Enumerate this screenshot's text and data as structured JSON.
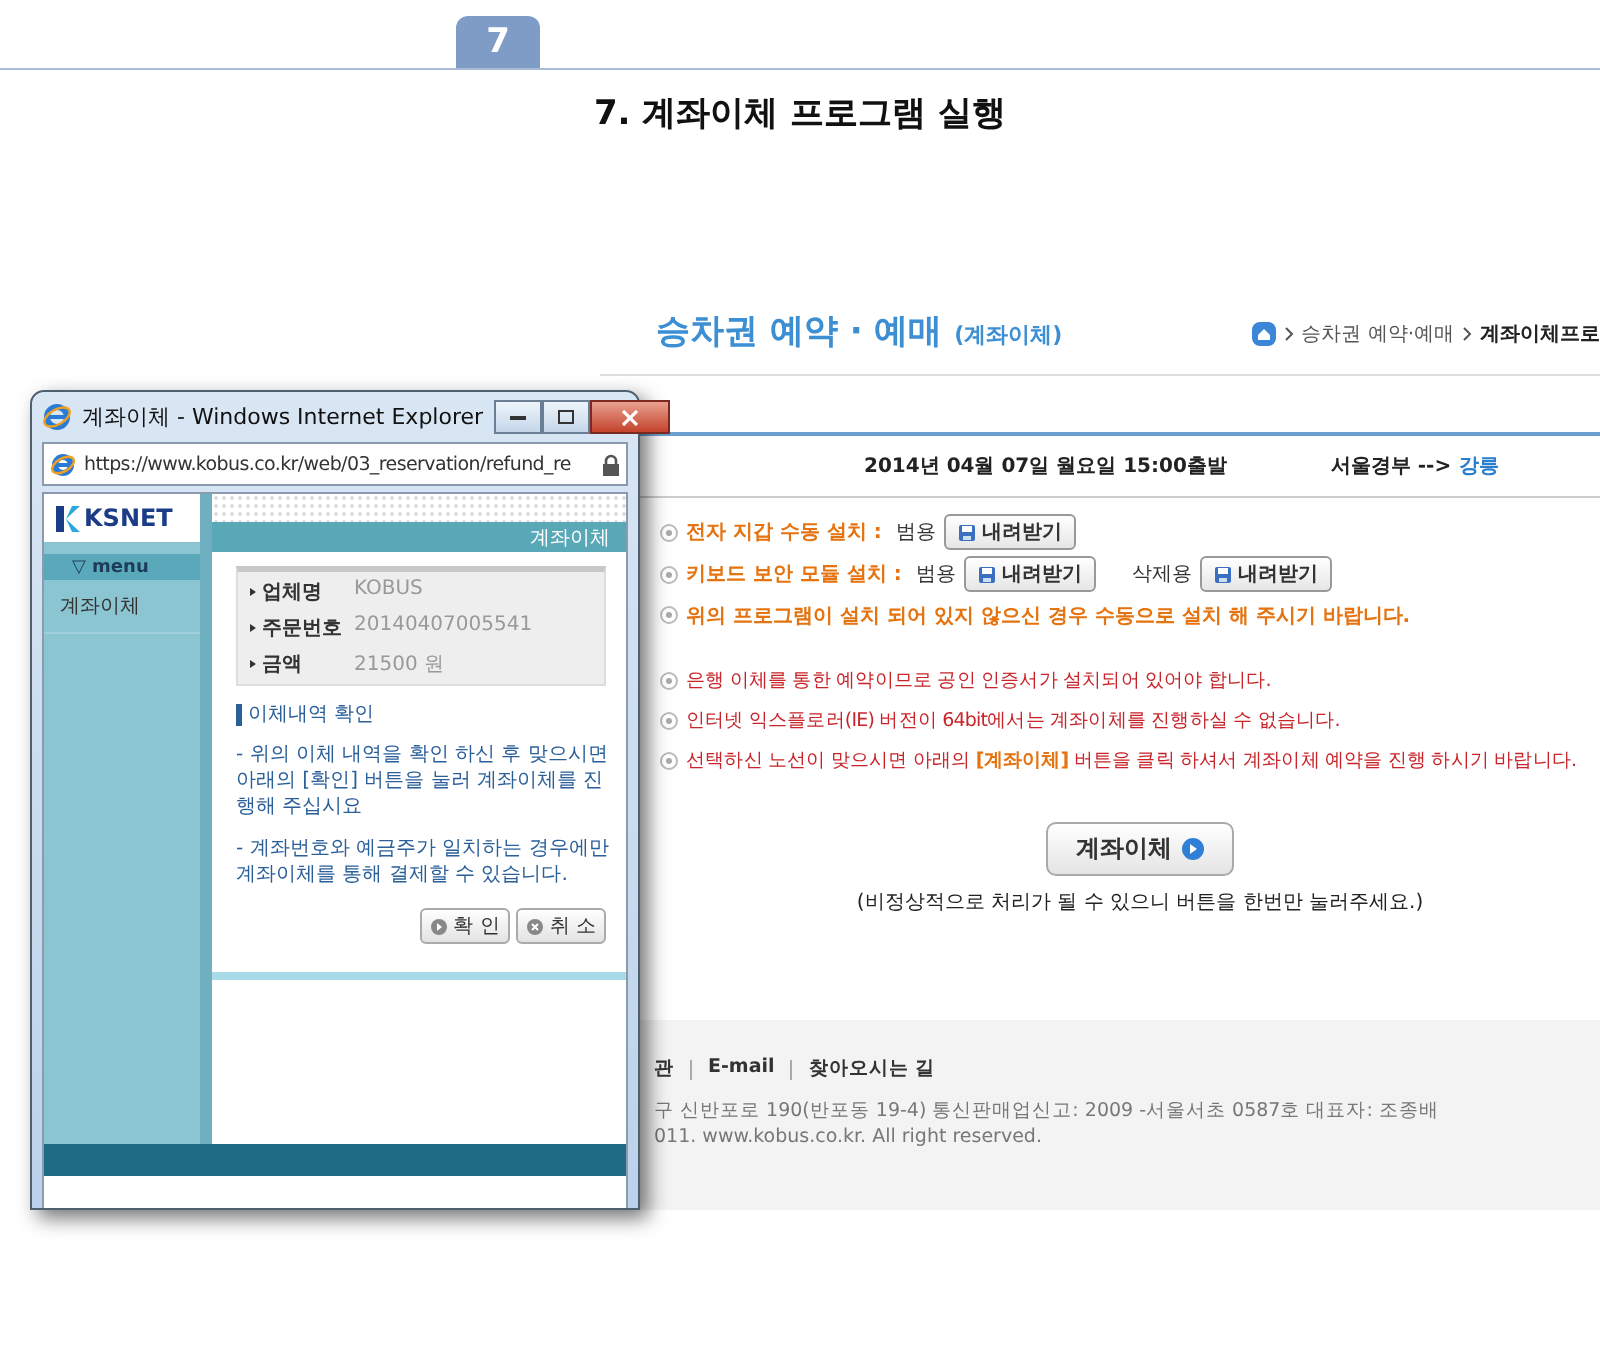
{
  "step": {
    "number": "7",
    "title": "7. 계좌이체 프로그램 실행"
  },
  "page": {
    "heading": "승차권 예약 · 예매",
    "heading_sub": "(계좌이체)",
    "breadcrumb": [
      "승차권 예약·예매",
      "계좌이체프로"
    ],
    "trip": {
      "date": "2014년 04월 07일 월요일 15:00출발",
      "route": "서울경부 -->",
      "destination": "강릉"
    },
    "install_items": [
      {
        "kind": "install",
        "label": "전자 지갑 수동 설치 :",
        "options": [
          {
            "label": "범용",
            "button": "내려받기"
          }
        ]
      },
      {
        "kind": "install",
        "label": "키보드 보안 모듈 설치 :",
        "options": [
          {
            "label": "범용",
            "button": "내려받기"
          },
          {
            "label": "삭제용",
            "button": "내려받기"
          }
        ]
      },
      {
        "kind": "notice",
        "label": "위의 프로그램이 설치 되어 있지 않으신 경우 수동으로 설치 해 주시기 바랍니다."
      }
    ],
    "notes": [
      "은행 이체를 통한 예약이므로 공인 인증서가 설치되어 있어야 합니다.",
      "인터넷 익스플로러(IE) 버전이 64bit에서는 계좌이체를 진행하실 수 없습니다.",
      "선택하신 노선이 맞으시면 아래의 **[계좌이체]** 버튼을 클릭 하셔서 계좌이체 예약을 진행 하시기 바랍니다."
    ],
    "transfer_button": "계좌이체",
    "button_note": "(비정상적으로 처리가 될 수 있으니 버튼을 한번만 눌러주세요.)",
    "footer": {
      "links": [
        "관",
        "E-mail",
        "찾아오시는 길"
      ],
      "lines": [
        "구 신반포로 190(반포동 19-4) 통신판매업신고: 2009 -서울서초 0587호   대표자: 조종배",
        "011. www.kobus.co.kr. All right reserved."
      ]
    }
  },
  "popup": {
    "title": "계좌이체 - Windows Internet Explorer",
    "address": "https://www.kobus.co.kr/web/03_reservation/refund_re",
    "logo": "KSNET",
    "menu_label": "▽ menu",
    "menu_items": [
      "계좌이체"
    ],
    "header": "계좌이체",
    "info": [
      {
        "label": "업체명",
        "value": "KOBUS"
      },
      {
        "label": "주문번호",
        "value": "20140407005541"
      },
      {
        "label": "금액",
        "value": "21500  원"
      }
    ],
    "section": "이체내역 확인",
    "paragraphs": [
      "- 위의 이체 내역을 확인 하신 후 맞으시면 아래의 [확인] 버튼을 눌러 계좌이체를 진행해 주십시요",
      "- 계좌번호와 예금주가 일치하는 경우에만 계좌이체를 통해 결제할 수 있습니다."
    ],
    "buttons": [
      {
        "kind": "ok",
        "label": "확 인"
      },
      {
        "kind": "cancel",
        "label": "취 소"
      }
    ]
  }
}
